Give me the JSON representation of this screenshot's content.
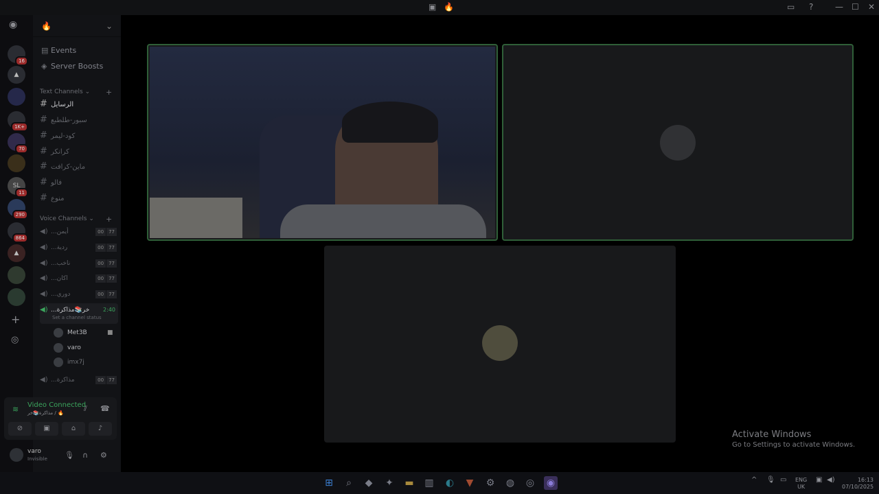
{
  "app": {
    "title_icon": "server-icon",
    "window_buttons": [
      "—",
      "☐",
      "✕"
    ]
  },
  "servers": [
    {
      "label": "",
      "badge": "16"
    },
    {
      "label": "▲",
      "badge": ""
    },
    {
      "label": "",
      "badge": ""
    },
    {
      "label": "",
      "badge": "1K+"
    },
    {
      "label": "",
      "badge": "70"
    },
    {
      "label": "",
      "badge": ""
    },
    {
      "label": "SL",
      "badge": "11"
    },
    {
      "label": "",
      "badge": "290"
    },
    {
      "label": "",
      "badge": "864"
    },
    {
      "label": "▲",
      "badge": ""
    },
    {
      "label": "",
      "badge": ""
    },
    {
      "label": "",
      "badge": ""
    }
  ],
  "guild": {
    "name": "🔥",
    "events": "Events",
    "boosts": "Server Boosts",
    "text_category": "Text Channels",
    "voice_category": "Voice Channels"
  },
  "text_channels": [
    "الرسايل",
    "سبور-طلطبع",
    "كود-ليمر",
    "كرانكر",
    "ماين-كرافت",
    "فالو",
    "منوع"
  ],
  "voice_channels": [
    {
      "name": "...أيمن",
      "a": "00",
      "b": "77"
    },
    {
      "name": "...ردية",
      "a": "00",
      "b": "77"
    },
    {
      "name": "...ناخب",
      "a": "00",
      "b": "77"
    },
    {
      "name": "...اكان",
      "a": "00",
      "b": "77"
    },
    {
      "name": "...دوري",
      "a": "00",
      "b": "77"
    }
  ],
  "current_voice": {
    "name": "...خر📚مذاكرة",
    "time": "2:40",
    "status": "Set a channel status"
  },
  "members": [
    "Met3B",
    "varo",
    "imx7j"
  ],
  "voice_after": {
    "name": "...مذاكرة",
    "a": "00",
    "b": "77"
  },
  "voice_panel": {
    "title": "Video Connected",
    "subtitle": "مذاكرة📚خر / 🔥"
  },
  "user": {
    "name": "varo",
    "status": "Invisible"
  },
  "watermark": {
    "line1": "Activate Windows",
    "line2": "Go to Settings to activate Windows."
  },
  "tray": {
    "lang1": "ENG",
    "lang2": "UK",
    "time": "16:13",
    "date": "07/10/2025"
  },
  "colors": {
    "accent_green": "#3ba55d",
    "badge_red": "#9b2a2a"
  }
}
